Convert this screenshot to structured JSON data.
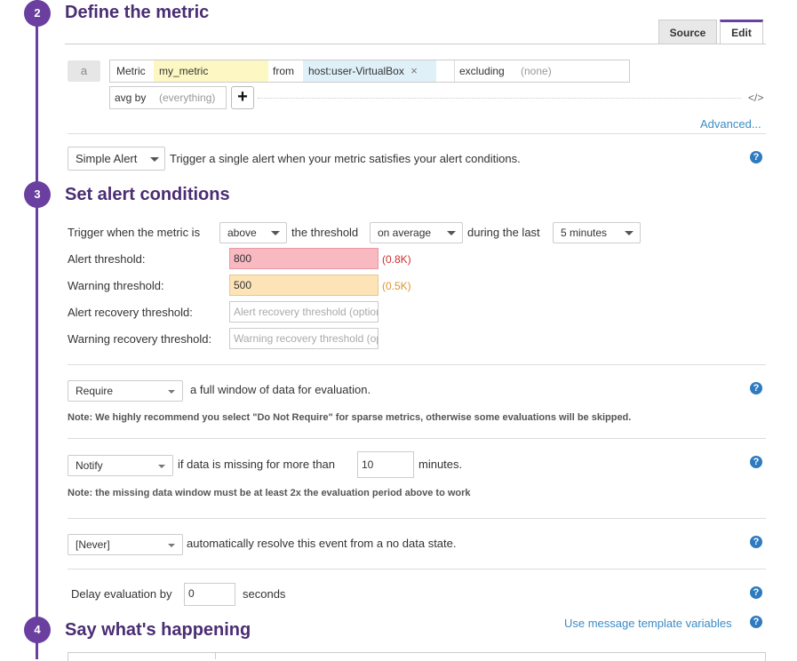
{
  "steps": {
    "s2": {
      "number": "2",
      "title": "Define the metric"
    },
    "s3": {
      "number": "3",
      "title": "Set alert conditions"
    },
    "s4": {
      "number": "4",
      "title": "Say what's happening"
    }
  },
  "tabs": {
    "source": "Source",
    "edit": "Edit"
  },
  "query": {
    "letter": "a",
    "metric_label": "Metric",
    "metric_value": "my_metric",
    "from_label": "from",
    "from_value": "host:user-VirtualBox",
    "remove_glyph": "×",
    "excluding_label": "excluding",
    "excluding_value": "(none)",
    "avgby_label": "avg by",
    "avgby_value": "(everything)",
    "add_glyph": "+",
    "code_glyph": "</>",
    "advanced": "Advanced..."
  },
  "alert_type": {
    "value": "Simple Alert",
    "description": "Trigger a single alert when your metric satisfies your alert conditions."
  },
  "conditions": {
    "trigger_prefix": "Trigger when the metric is",
    "comparator": "above",
    "threshold_text": "the threshold",
    "aggregation": "on average",
    "during_text": "during the last",
    "window": "5 minutes",
    "alert_label": "Alert threshold:",
    "alert_value": "800",
    "alert_hint": "(0.8K)",
    "warning_label": "Warning threshold:",
    "warning_value": "500",
    "warning_hint": "(0.5K)",
    "alert_recovery_label": "Alert recovery threshold:",
    "alert_recovery_placeholder": "Alert recovery threshold (optional)",
    "warning_recovery_label": "Warning recovery threshold:",
    "warning_recovery_placeholder": "Warning recovery threshold (optional)"
  },
  "require": {
    "value": "Require",
    "text": "a full window of data for evaluation.",
    "note": "Note: We highly recommend you select \"Do Not Require\" for sparse metrics, otherwise some evaluations will be skipped."
  },
  "missing": {
    "value": "Notify",
    "text": "if data is missing for more than",
    "minutes_value": "10",
    "unit": "minutes.",
    "note": "Note: the missing data window must be at least 2x the evaluation period above to work"
  },
  "resolve": {
    "value": "[Never]",
    "text": "automatically resolve this event from a no data state."
  },
  "delay": {
    "label": "Delay evaluation by",
    "value": "0",
    "unit": "seconds"
  },
  "message": {
    "template_link": "Use message template variables"
  },
  "help_glyph": "?",
  "colors": {
    "accent": "#6a3fa0",
    "alert_bg": "#f8b9c1",
    "warning_bg": "#fde4b8",
    "link": "#3b8cc4"
  }
}
